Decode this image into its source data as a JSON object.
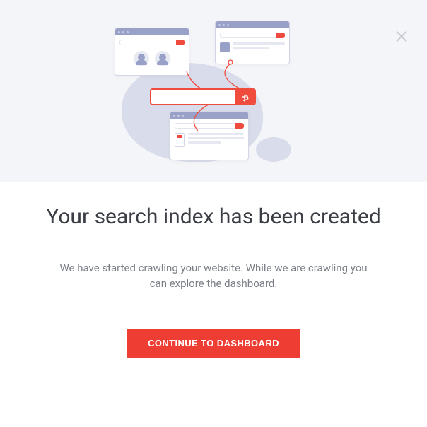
{
  "modal": {
    "title": "Your search index has been created",
    "description": "We have started crawling your website. While we are crawling you can explore the dashboard.",
    "cta_label": "CONTINUE TO DASHBOARD"
  },
  "colors": {
    "accent": "#ee3d32",
    "hero_bg": "#f4f5f8",
    "illus_primary": "#9aa1c8"
  }
}
